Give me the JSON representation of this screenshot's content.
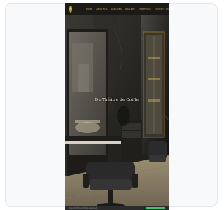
{
  "site": {
    "nav": {
      "items": [
        "HOME",
        "ABOUT US",
        "SERVICES",
        "GALLERY",
        "PORTFOLIO",
        "CONTACT US"
      ]
    },
    "hero": {
      "title": "Du Théâtre de Coiffe"
    },
    "footer": {
      "text": "Copyright © All rights reserved",
      "button": ""
    }
  },
  "colors": {
    "accent_gold": "#c9a756",
    "whatsapp_green": "#3fc46a"
  }
}
